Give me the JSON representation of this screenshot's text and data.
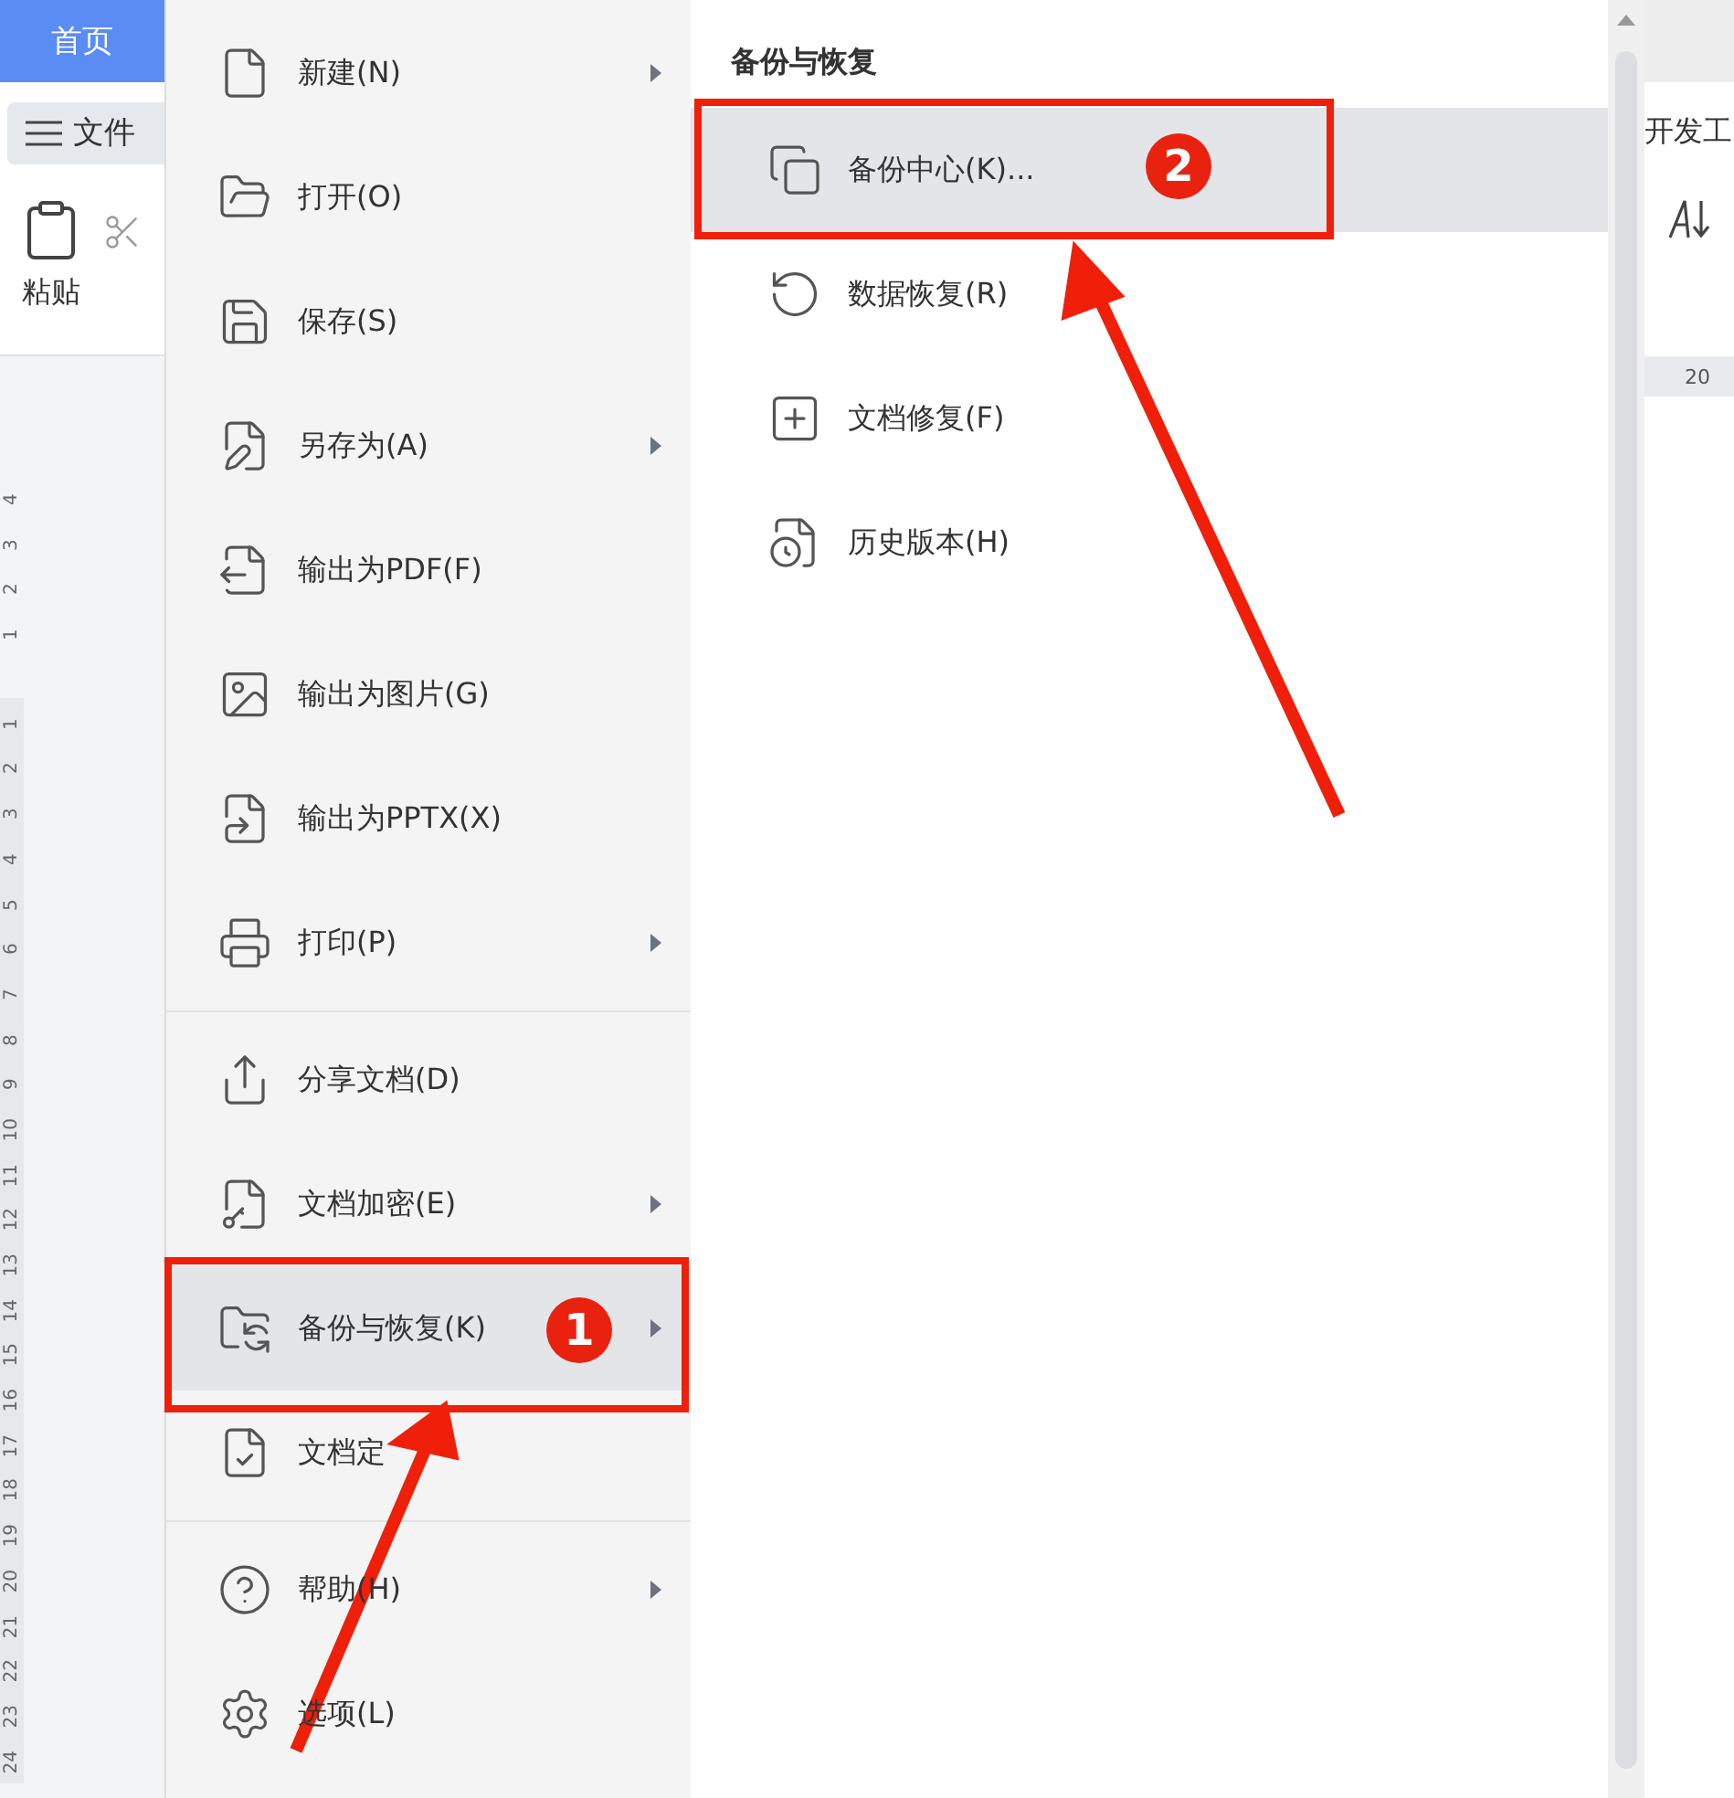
{
  "app": {
    "home_tab": "首页",
    "file_button": "文件",
    "paste_label": "粘贴",
    "right_tab_fragment": "开发工",
    "ruler_mark": "20"
  },
  "vertical_ruler": {
    "top_labels": [
      "4",
      "3",
      "2",
      "1"
    ],
    "labels": [
      "1",
      "2",
      "3",
      "4",
      "5",
      "6",
      "7",
      "8",
      "9",
      "10",
      "11",
      "12",
      "13",
      "14",
      "15",
      "16",
      "17",
      "18",
      "19",
      "20",
      "21",
      "22",
      "23",
      "24"
    ]
  },
  "file_menu": {
    "groups": [
      [
        {
          "label": "新建(N)",
          "has_submenu": true,
          "selected": false
        },
        {
          "label": "打开(O)",
          "has_submenu": false,
          "selected": false
        },
        {
          "label": "保存(S)",
          "has_submenu": false,
          "selected": false
        },
        {
          "label": "另存为(A)",
          "has_submenu": true,
          "selected": false
        },
        {
          "label": "输出为PDF(F)",
          "has_submenu": false,
          "selected": false
        },
        {
          "label": "输出为图片(G)",
          "has_submenu": false,
          "selected": false
        },
        {
          "label": "输出为PPTX(X)",
          "has_submenu": false,
          "selected": false
        },
        {
          "label": "打印(P)",
          "has_submenu": true,
          "selected": false
        }
      ],
      [
        {
          "label": "分享文档(D)",
          "has_submenu": false,
          "selected": false
        },
        {
          "label": "文档加密(E)",
          "has_submenu": true,
          "selected": false
        },
        {
          "label": "备份与恢复(K)",
          "has_submenu": true,
          "selected": true
        },
        {
          "label": "文档定",
          "has_submenu": false,
          "selected": false
        }
      ],
      [
        {
          "label": "帮助(H)",
          "has_submenu": true,
          "selected": false
        },
        {
          "label": "选项(L)",
          "has_submenu": false,
          "selected": false
        }
      ]
    ]
  },
  "submenu": {
    "title": "备份与恢复",
    "items": [
      {
        "label": "备份中心(K)...",
        "selected": true
      },
      {
        "label": "数据恢复(R)",
        "selected": false
      },
      {
        "label": "文档修复(F)",
        "selected": false
      },
      {
        "label": "历史版本(H)",
        "selected": false
      }
    ]
  },
  "callouts": [
    {
      "number": "1"
    },
    {
      "number": "2"
    }
  ]
}
